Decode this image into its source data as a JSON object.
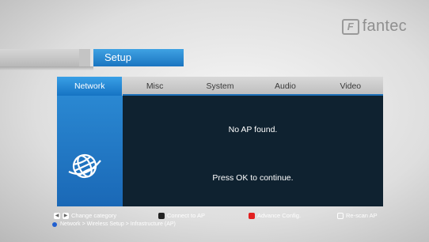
{
  "brand": {
    "logo_glyph": "F",
    "name": "fantec"
  },
  "setup": {
    "title": "Setup"
  },
  "tabs": [
    {
      "label": "Network",
      "active": true
    },
    {
      "label": "Misc",
      "active": false
    },
    {
      "label": "System",
      "active": false
    },
    {
      "label": "Audio",
      "active": false
    },
    {
      "label": "Video",
      "active": false
    }
  ],
  "content": {
    "message": "No AP found.",
    "prompt": "Press OK to continue."
  },
  "left_panel": {
    "icon": "globe-network-icon"
  },
  "footer": {
    "hints": [
      {
        "keys": [
          "left-arrow-key",
          "right-arrow-key"
        ],
        "label": "Change category"
      },
      {
        "keys": [
          "black-key"
        ],
        "label": "Connect to AP"
      },
      {
        "keys": [
          "red-key"
        ],
        "label": "Advance Config."
      },
      {
        "keys": [
          "rescan-key"
        ],
        "label": "Re-scan AP"
      }
    ],
    "breadcrumb": "Network > Wireless Setup > Infrastructure (AP)"
  },
  "colors": {
    "accent": "#1a74c0",
    "panel": "#0f2230",
    "red_key": "#e22020"
  }
}
